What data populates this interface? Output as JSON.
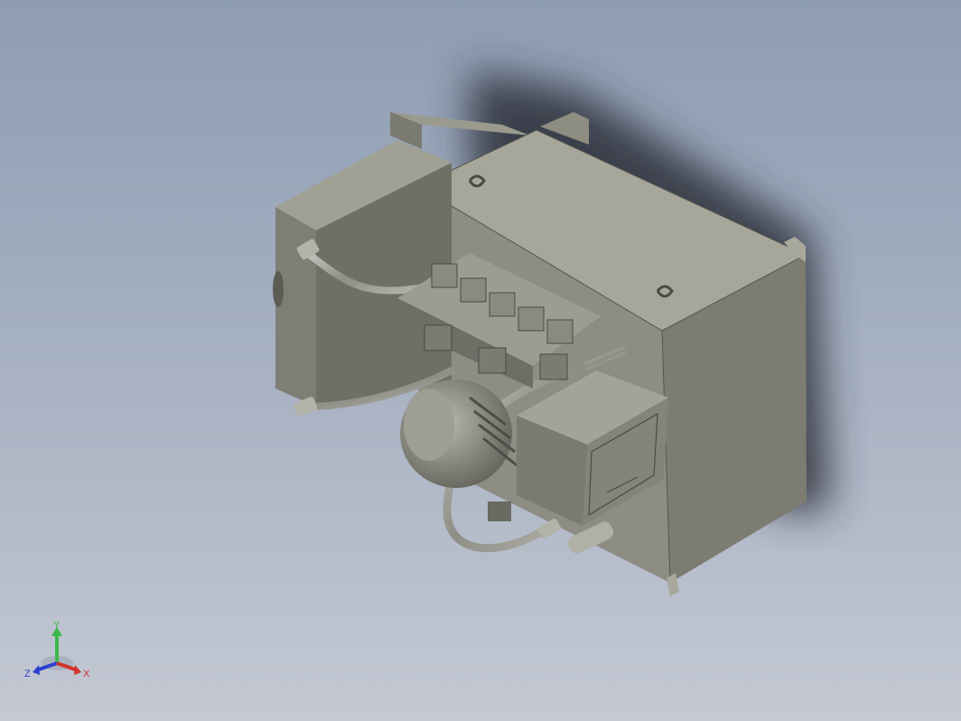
{
  "viewport": {
    "background_top": "#8e9db3",
    "background_bottom": "#c4c9d3"
  },
  "model": {
    "body_color": "#8a8a7e",
    "light_color": "#a2a296",
    "dark_color": "#63635a",
    "hose_color": "#9d9d95"
  },
  "triad": {
    "y_label": "Y",
    "z_label": "Z",
    "x_label": "X",
    "y_color": "#3cb84a",
    "z_color": "#2b3fd0",
    "x_color": "#d2322b"
  }
}
